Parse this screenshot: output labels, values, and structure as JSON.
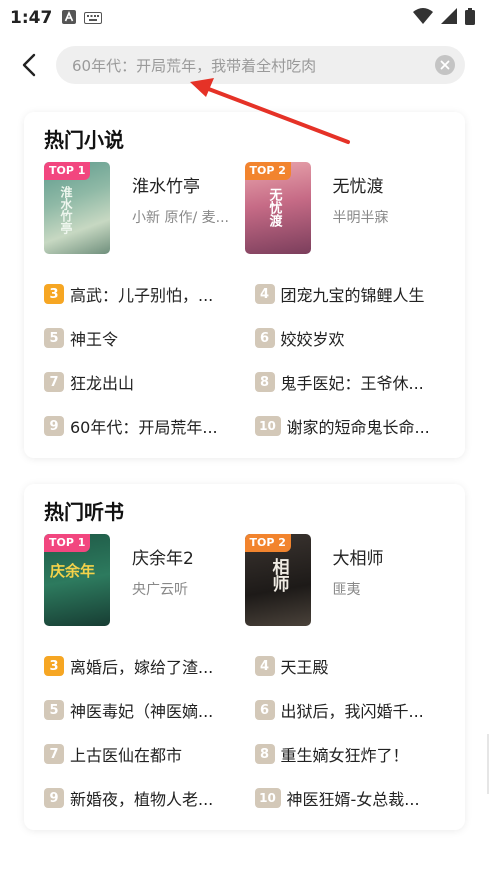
{
  "status": {
    "time": "1:47"
  },
  "search": {
    "text": "60年代：开局荒年，我带着全村吃肉"
  },
  "sections": [
    {
      "title": "热门小说",
      "tops": [
        {
          "badge": "TOP 1",
          "badge_color": "#f2467f",
          "name": "淮水竹亭",
          "author": "小新 原作/ 麦...",
          "cover_text": "淮水竹亭",
          "cover_bg": "linear-gradient(160deg,#5d9a8c 0%,#8fb9a6 40%,#c7d8c2 70%,#6f8f7c 100%)"
        },
        {
          "badge": "TOP 2",
          "badge_color": "#f2842e",
          "name": "无忧渡",
          "author": "半明半寐",
          "cover_text": "无忧渡",
          "cover_bg": "linear-gradient(170deg,#e9a6ad 0%,#c66b86 45%,#7b3e5c 100%)"
        }
      ],
      "items": [
        {
          "rank": "3",
          "title": "高武：儿子别怕，..."
        },
        {
          "rank": "4",
          "title": "团宠九宝的锦鲤人生"
        },
        {
          "rank": "5",
          "title": "神王令"
        },
        {
          "rank": "6",
          "title": "姣姣岁欢"
        },
        {
          "rank": "7",
          "title": "狂龙出山"
        },
        {
          "rank": "8",
          "title": "鬼手医妃：王爷休..."
        },
        {
          "rank": "9",
          "title": "60年代：开局荒年..."
        },
        {
          "rank": "10",
          "title": "谢家的短命鬼长命..."
        }
      ]
    },
    {
      "title": "热门听书",
      "tops": [
        {
          "badge": "TOP 1",
          "badge_color": "#f2467f",
          "name": "庆余年2",
          "author": "央广云听",
          "cover_text": "庆余年",
          "cover_bg": "linear-gradient(170deg,#1f5a47 0%,#2d7a5e 50%,#173d33 100%)"
        },
        {
          "badge": "TOP 2",
          "badge_color": "#f2842e",
          "name": "大相师",
          "author": "匪夷",
          "cover_text": "相师",
          "cover_bg": "linear-gradient(170deg,#3b3430 0%,#1d1a18 60%,#4a423a 100%)"
        }
      ],
      "items": [
        {
          "rank": "3",
          "title": "离婚后，嫁给了渣..."
        },
        {
          "rank": "4",
          "title": "天王殿"
        },
        {
          "rank": "5",
          "title": "神医毒妃（神医嫡..."
        },
        {
          "rank": "6",
          "title": "出狱后，我闪婚千..."
        },
        {
          "rank": "7",
          "title": "上古医仙在都市"
        },
        {
          "rank": "8",
          "title": "重生嫡女狂炸了！"
        },
        {
          "rank": "9",
          "title": "新婚夜，植物人老..."
        },
        {
          "rank": "10",
          "title": "神医狂婿-女总裁..."
        }
      ]
    }
  ]
}
